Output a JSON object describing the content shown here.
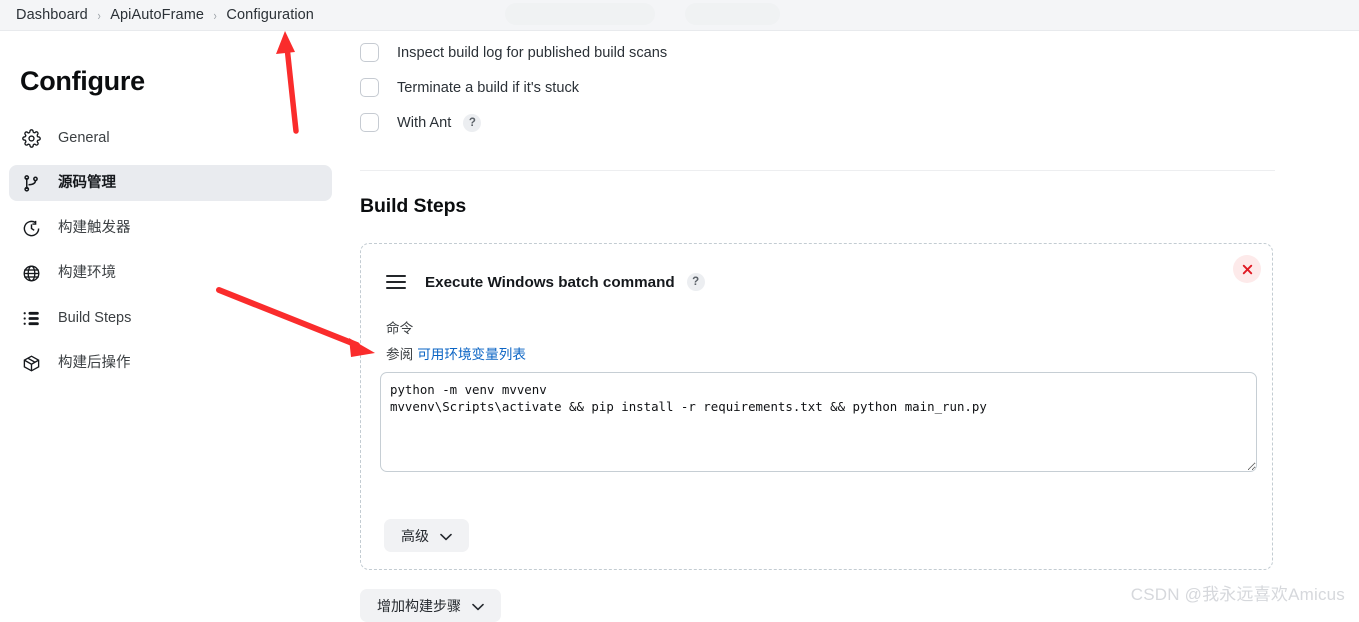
{
  "breadcrumb": {
    "items": [
      {
        "label": "Dashboard"
      },
      {
        "label": "ApiAutoFrame"
      },
      {
        "label": "Configuration"
      }
    ],
    "separator": "›"
  },
  "sidebar": {
    "title": "Configure",
    "items": [
      {
        "label": "General",
        "icon": "gear-icon",
        "selected": false
      },
      {
        "label": "源码管理",
        "icon": "git-branch-icon",
        "selected": true
      },
      {
        "label": "构建触发器",
        "icon": "clock-icon",
        "selected": false
      },
      {
        "label": "构建环境",
        "icon": "globe-icon",
        "selected": false
      },
      {
        "label": "Build Steps",
        "icon": "list-icon",
        "selected": false
      },
      {
        "label": "构建后操作",
        "icon": "package-icon",
        "selected": false
      }
    ]
  },
  "main": {
    "checkboxes": [
      {
        "label": "Inspect build log for published build scans",
        "checked": false,
        "help": false
      },
      {
        "label": "Terminate a build if it's stuck",
        "checked": false,
        "help": false
      },
      {
        "label": "With Ant",
        "checked": false,
        "help": true,
        "help_glyph": "?"
      }
    ],
    "build_steps_heading": "Build Steps",
    "step": {
      "title": "Execute Windows batch command",
      "help_glyph": "?",
      "close_glyph": "✕",
      "command_label": "命令",
      "see_prefix": "参阅",
      "see_link": "可用环境变量列表",
      "command_value": "python -m venv mvvenv\nmvvenv\\Scripts\\activate && pip install -r requirements.txt && python main_run.py",
      "command_placeholder": "",
      "advanced_label": "高级",
      "chevron": "⌄"
    },
    "add_step_label": "增加构建步骤",
    "add_step_chevron": "⌄"
  },
  "watermark": "CSDN @我永远喜欢Amicus",
  "colors": {
    "accent_link": "#0b64c4",
    "annotation_red": "#fa2c2c",
    "selected_nav_bg": "#e9ebef",
    "breadcrumb_bg": "#f4f5f7",
    "close_bg": "#fdeaea",
    "close_fg": "#e01b24"
  }
}
